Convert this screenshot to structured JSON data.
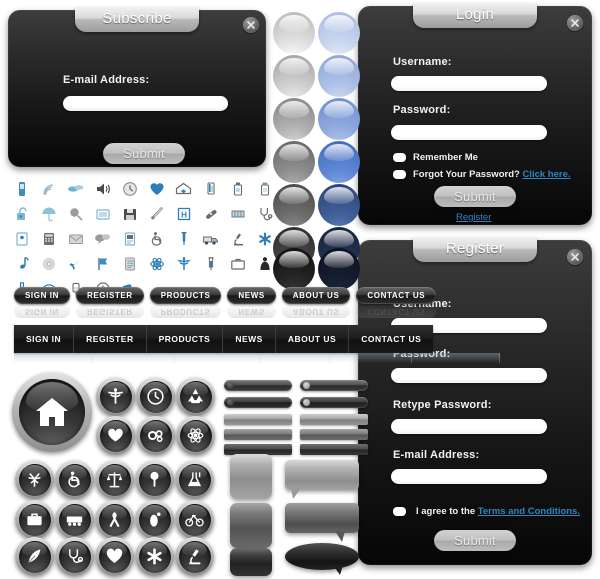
{
  "subscribe_panel": {
    "title": "Subscribe",
    "close_icon": "close-icon",
    "email_label": "E-mail Address:",
    "email_value": "",
    "email_placeholder": "",
    "submit_label": "Submit"
  },
  "login_panel": {
    "title": "Login",
    "close_icon": "close-icon",
    "username_label": "Username:",
    "username_value": "",
    "password_label": "Password:",
    "password_value": "",
    "remember_label": "Remember Me",
    "forgot_label": "Forgot Your Password?",
    "forgot_link": "Click here.",
    "submit_label": "Submit",
    "register_link": "Register"
  },
  "register_panel": {
    "title": "Register",
    "close_icon": "close-icon",
    "username_label": "Username:",
    "username_value": "",
    "password_label": "Password:",
    "password_value": "",
    "retype_label": "Retype Password:",
    "retype_value": "",
    "email_label": "E-mail Address:",
    "email_value": "",
    "agree_label": "I agree to the",
    "terms_link": "Terms and Conditions.",
    "submit_label": "Submit"
  },
  "orbs": {
    "grey": [
      "#d0d0d0",
      "#bcbcbc",
      "#9a9a9a",
      "#7b7b7b",
      "#5b5b5b",
      "#3d3d3d",
      "#222222"
    ],
    "blue": [
      "#b9c9e9",
      "#9db3df",
      "#7e9dd6",
      "#4d7fcf",
      "#3c5e9e",
      "#23375f",
      "#141d2f"
    ]
  },
  "icon_grid": {
    "row1": [
      "phone-icon",
      "wifi-icon",
      "paperclip-icon",
      "speaker-icon",
      "clock-icon",
      "heart-icon",
      "hospital-icon",
      "iv-drip-icon",
      "medicine-bottle-icon",
      "pill-bottle-icon"
    ],
    "row2": [
      "unlock-icon",
      "umbrella-icon",
      "magnifier-icon",
      "picture-icon",
      "floppy-disk-icon",
      "thermometer-icon",
      "hospital-sign-icon",
      "bandage-icon",
      "pill-pack-icon",
      "stethoscope-icon"
    ],
    "row3": [
      "book-icon",
      "calculator-icon",
      "envelope-icon",
      "chat-icon",
      "id-card-icon",
      "wheelchair-icon",
      "syringe-needle-icon",
      "ambulance-icon",
      "microscope-icon",
      "asterisk-icon"
    ],
    "row4": [
      "music-note-icon",
      "cd-icon",
      "airplane-icon",
      "flag-icon",
      "document-icon",
      "atom-icon",
      "caduceus-icon",
      "syringe-icon",
      "briefcase-icon",
      "nurse-icon"
    ],
    "row5": [
      "flask-icon",
      "eye-icon",
      "iv-bag-icon",
      "watch-icon",
      "capsules-icon"
    ],
    "color_blue": "#3e8fc0",
    "color_grey": "#b9b9b9"
  },
  "nav_pills": {
    "items": [
      "SIGN IN",
      "REGISTER",
      "PRODUCTS",
      "NEWS",
      "ABOUT US",
      "CONTACT US"
    ]
  },
  "nav_segments": {
    "items": [
      "SIGN IN",
      "REGISTER",
      "PRODUCTS",
      "NEWS",
      "ABOUT US",
      "CONTACT US"
    ]
  },
  "round_buttons": {
    "hero": "home-icon",
    "items": [
      "caduceus-icon",
      "clock-icon",
      "recycle-icon",
      "heart-hand-icon",
      "gears-icon",
      "atom-icon",
      "tree-icon",
      "wheelchair-icon",
      "scales-icon",
      "pin-icon",
      "lab-flask-icon",
      "briefcase-icon",
      "train-icon",
      "ribbon-icon",
      "footprint-icon",
      "bicycle-icon",
      "feather-icon",
      "stethoscope-icon",
      "heart-icon",
      "asterisk-icon",
      "microscope-icon"
    ]
  },
  "bars": {
    "pill_shades": [
      "#4a4a4a",
      "#3a3a3a"
    ],
    "flat_shades": [
      "#8d8d8d",
      "#6d6d6d",
      "#4a4a4a"
    ]
  },
  "squares": {
    "shades": [
      "#9c9c9c",
      "#6a6a6a",
      "#3c3c3c"
    ]
  },
  "bubbles": {
    "shades": [
      "#9c9c9c",
      "#6a6a6a",
      "#242424"
    ]
  },
  "colors": {
    "panel_top": "#3d3d3d",
    "panel_bottom": "#060606",
    "link": "#2e86c0",
    "title_text": "#ffffff",
    "submit_text": "#e8e8e8"
  }
}
